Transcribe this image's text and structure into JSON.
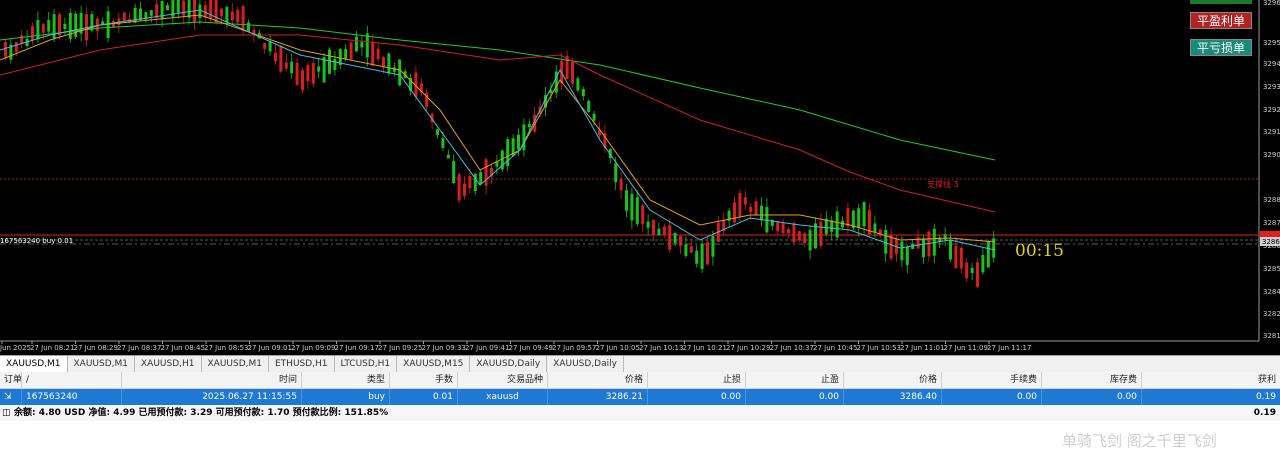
{
  "colors": {
    "bull": "#d81e1e",
    "bear": "#19c419",
    "ma_green": "#22cc22",
    "ma_red": "#d02020",
    "ma_orange": "#e0a020",
    "ma_cyan": "#40c0e0",
    "hline_red": "#e02020",
    "hline_grey": "#b0b0b0"
  },
  "chart": {
    "price_axis": [
      "3296.",
      "3295.",
      "3294.",
      "3293.",
      "3292.",
      "3291.",
      "3290.",
      "3288.",
      "3287.",
      "3286.",
      "3285.",
      "3284.",
      "3282.",
      "3281."
    ],
    "current_price_tag": "3286.4",
    "time_axis": [
      "Jun 2025",
      "27 Jun 08:21",
      "27 Jun 08:29",
      "27 Jun 08:37",
      "27 Jun 08:45",
      "27 Jun 08:53",
      "27 Jun 09:01",
      "27 Jun 09:09",
      "27 Jun 09:17",
      "27 Jun 09:25",
      "27 Jun 09:33",
      "27 Jun 09:41",
      "27 Jun 09:49",
      "27 Jun 09:57",
      "27 Jun 10:05",
      "27 Jun 10:13",
      "27 Jun 10:21",
      "27 Jun 10:29",
      "27 Jun 10:37",
      "27 Jun 10:45",
      "27 Jun 10:53",
      "27 Jun 11:01",
      "27 Jun 11:09",
      "27 Jun 11:17"
    ],
    "support_label": "支撑线 3",
    "order_line_label": "167563240 buy 0.01",
    "timer": "00:15",
    "buttons": {
      "take_profit": "平盈利单",
      "stop_loss": "平亏损单"
    }
  },
  "tabs": [
    {
      "label": "XAUUSD,M1",
      "active": true
    },
    {
      "label": "XAUUSD,M1"
    },
    {
      "label": "XAUUSD,H1"
    },
    {
      "label": "XAUUSD,M1"
    },
    {
      "label": "ETHUSD,H1"
    },
    {
      "label": "LTCUSD,H1"
    },
    {
      "label": "XAUUSD,M15"
    },
    {
      "label": "XAUUSD,Daily"
    },
    {
      "label": "XAUUSD,Daily"
    }
  ],
  "table": {
    "headers": [
      "订单",
      "/",
      "时间",
      "类型",
      "手数",
      "交易品种",
      "价格",
      "止损",
      "止盈",
      "价格",
      "手续费",
      "库存费",
      "获利"
    ],
    "row": {
      "order": "167563240",
      "time": "2025.06.27 11:15:55",
      "type": "buy",
      "lots": "0.01",
      "symbol": "xauusd",
      "open_price": "3286.21",
      "sl": "0.00",
      "tp": "0.00",
      "price": "3286.40",
      "commission": "0.00",
      "swap": "0.00",
      "profit": "0.19"
    },
    "summary": {
      "text": "余额: 4.80 USD  净值: 4.99  已用预付款: 3.29  可用预付款: 1.70  预付款比例: 151.85%",
      "profit": "0.19"
    }
  },
  "watermark": "单骑飞剑 阁之千里飞剑"
}
